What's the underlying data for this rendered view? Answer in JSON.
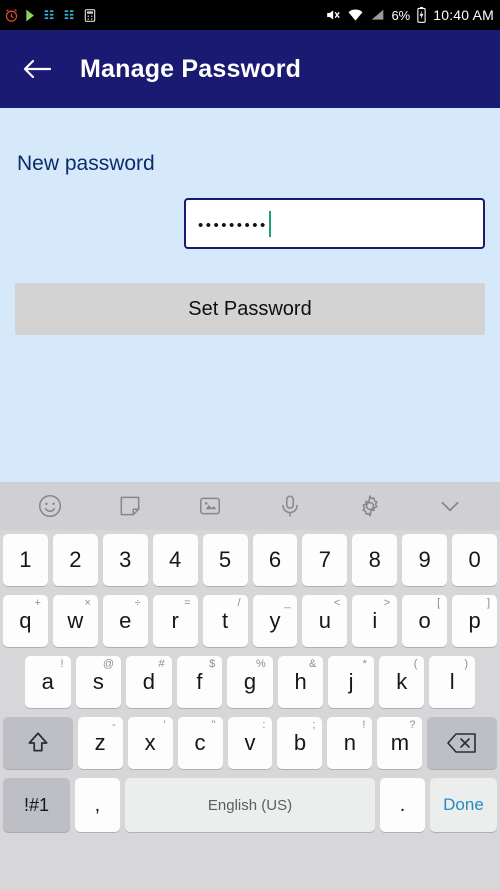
{
  "status_bar": {
    "left_icons": [
      "alarm-clock-icon",
      "play-store-icon",
      "equalizer-icon",
      "equalizer-icon-2",
      "calculator-icon"
    ],
    "mute_icon": "mute-icon",
    "wifi_icon": "wifi-icon",
    "signal_icon": "signal-icon",
    "battery_percent": "6%",
    "battery_icon": "battery-charging-icon",
    "time": "10:40 AM"
  },
  "appbar": {
    "back_icon": "back-arrow-icon",
    "title": "Manage Password"
  },
  "form": {
    "label": "New password",
    "password_value": "•••••••••",
    "password_placeholder": ""
  },
  "button": {
    "set_password": "Set Password"
  },
  "keyboard": {
    "toolbar": [
      "emoji-icon",
      "sticker-icon",
      "gif-icon",
      "microphone-icon",
      "settings-gear-icon",
      "chevron-down-icon"
    ],
    "row1": [
      {
        "main": "1"
      },
      {
        "main": "2"
      },
      {
        "main": "3"
      },
      {
        "main": "4"
      },
      {
        "main": "5"
      },
      {
        "main": "6"
      },
      {
        "main": "7"
      },
      {
        "main": "8"
      },
      {
        "main": "9"
      },
      {
        "main": "0"
      }
    ],
    "row2": [
      {
        "main": "q",
        "sup": "+"
      },
      {
        "main": "w",
        "sup": "×"
      },
      {
        "main": "e",
        "sup": "÷"
      },
      {
        "main": "r",
        "sup": "="
      },
      {
        "main": "t",
        "sup": "/"
      },
      {
        "main": "y",
        "sup": "_"
      },
      {
        "main": "u",
        "sup": "<"
      },
      {
        "main": "i",
        "sup": ">"
      },
      {
        "main": "o",
        "sup": "["
      },
      {
        "main": "p",
        "sup": "]"
      }
    ],
    "row3": [
      {
        "main": "a",
        "sup": "!"
      },
      {
        "main": "s",
        "sup": "@"
      },
      {
        "main": "d",
        "sup": "#"
      },
      {
        "main": "f",
        "sup": "$"
      },
      {
        "main": "g",
        "sup": "%"
      },
      {
        "main": "h",
        "sup": "&"
      },
      {
        "main": "j",
        "sup": "*"
      },
      {
        "main": "k",
        "sup": "("
      },
      {
        "main": "l",
        "sup": ")"
      }
    ],
    "row4": {
      "shift": "shift-icon",
      "keys": [
        {
          "main": "z",
          "sup": "-"
        },
        {
          "main": "x",
          "sup": "'"
        },
        {
          "main": "c",
          "sup": "\""
        },
        {
          "main": "v",
          "sup": ":"
        },
        {
          "main": "b",
          "sup": ";"
        },
        {
          "main": "n",
          "sup": "!"
        },
        {
          "main": "m",
          "sup": "?"
        }
      ],
      "backspace": "backspace-icon"
    },
    "row5": {
      "symbols": "!#1",
      "comma": ",",
      "space": "English (US)",
      "period": ".",
      "done": "Done"
    }
  }
}
